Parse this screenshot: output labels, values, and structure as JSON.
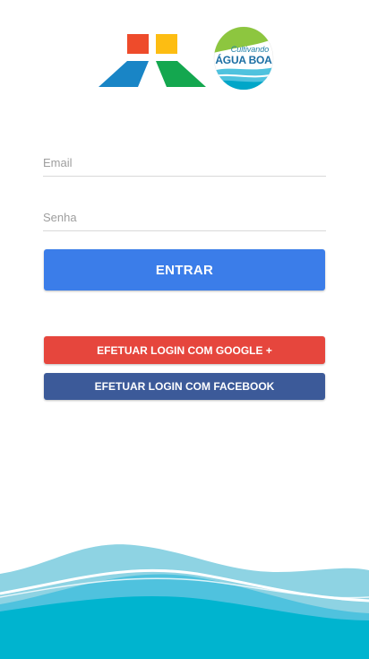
{
  "logo": {
    "badge_line1": "Cultivando",
    "badge_line2": "ÁGUA BOA",
    "colors": {
      "red": "#ee4b2b",
      "yellow": "#fdbd12",
      "blue": "#1985c6",
      "green": "#14a74f",
      "badge_green": "#8dc63f",
      "badge_blue": "#1b6ea3"
    }
  },
  "form": {
    "email_placeholder": "Email",
    "password_placeholder": "Senha",
    "login_label": "ENTRAR"
  },
  "social": {
    "google_label": "EFETUAR LOGIN COM GOOGLE +",
    "facebook_label": "EFETUAR LOGIN COM FACEBOOK"
  },
  "colors": {
    "primary": "#3b7de9",
    "google": "#e6463d",
    "facebook": "#3c5a99",
    "wave_light": "#8ed3e3",
    "wave_mid": "#4fc2de",
    "wave_dark": "#00b4cf"
  }
}
